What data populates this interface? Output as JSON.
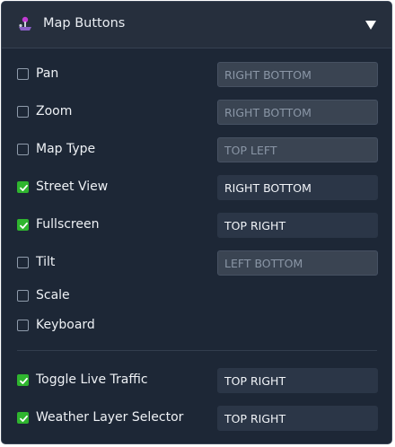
{
  "header": {
    "title": "Map Buttons",
    "icon": "joystick-icon",
    "collapse_icon": "triangle-down-icon"
  },
  "colors": {
    "panel_bg": "#1d2736",
    "header_bg": "#262f3d",
    "checked": "#2fb52f",
    "disabled_field_bg": "#3a4452",
    "enabled_field_bg": "#2b3647"
  },
  "controls": [
    {
      "id": "pan",
      "label": "Pan",
      "checked": false,
      "position": "RIGHT BOTTOM"
    },
    {
      "id": "zoom",
      "label": "Zoom",
      "checked": false,
      "position": "RIGHT BOTTOM"
    },
    {
      "id": "map-type",
      "label": "Map Type",
      "checked": false,
      "position": "TOP LEFT"
    },
    {
      "id": "street-view",
      "label": "Street View",
      "checked": true,
      "position": "RIGHT BOTTOM"
    },
    {
      "id": "fullscreen",
      "label": "Fullscreen",
      "checked": true,
      "position": "TOP RIGHT"
    },
    {
      "id": "tilt",
      "label": "Tilt",
      "checked": false,
      "position": "LEFT BOTTOM"
    },
    {
      "id": "scale",
      "label": "Scale",
      "checked": false
    },
    {
      "id": "keyboard",
      "label": "Keyboard",
      "checked": false
    }
  ],
  "extras": [
    {
      "id": "toggle-live-traffic",
      "label": "Toggle Live Traffic",
      "checked": true,
      "position": "TOP RIGHT"
    },
    {
      "id": "weather-layer-selector",
      "label": "Weather Layer Selector",
      "checked": true,
      "position": "TOP RIGHT"
    }
  ]
}
